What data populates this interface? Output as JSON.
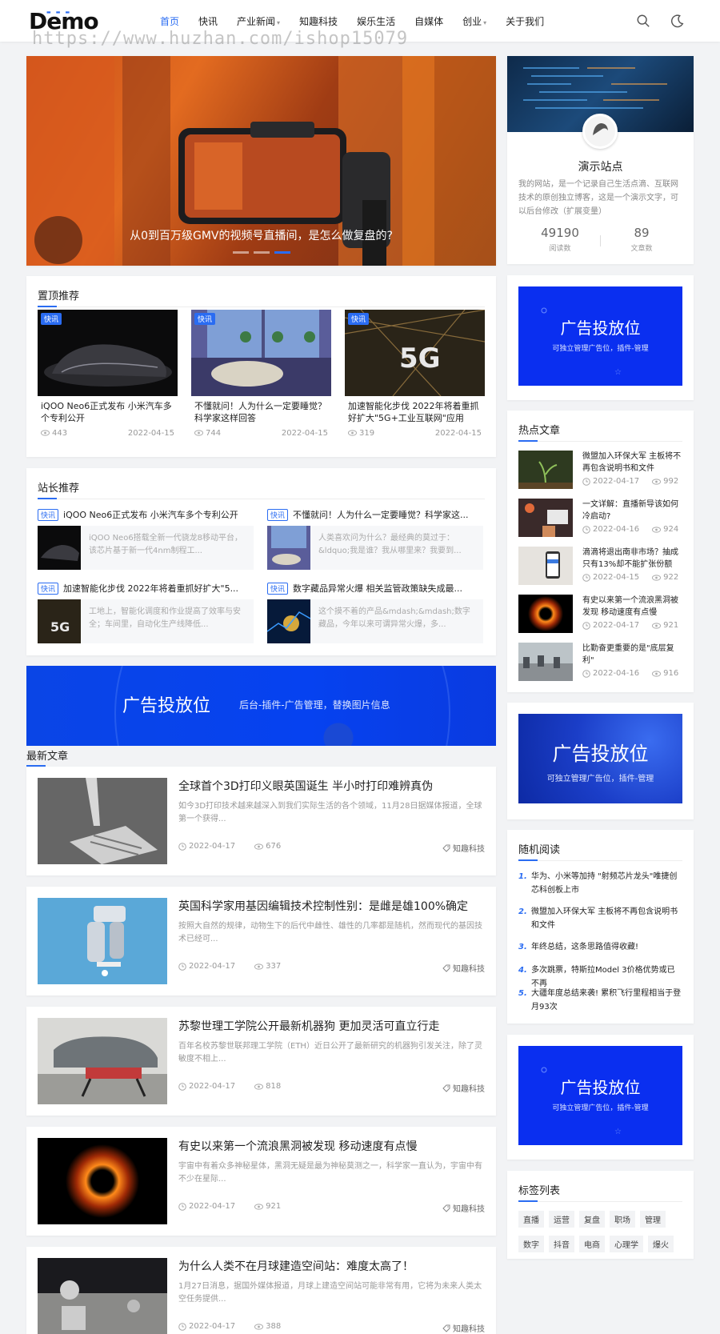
{
  "header": {
    "logo": "Demo",
    "nav": [
      {
        "label": "首页",
        "active": true,
        "has_dropdown": false
      },
      {
        "label": "快讯",
        "active": false,
        "has_dropdown": false
      },
      {
        "label": "产业新闻",
        "active": false,
        "has_dropdown": true
      },
      {
        "label": "知趣科技",
        "active": false,
        "has_dropdown": false
      },
      {
        "label": "娱乐生活",
        "active": false,
        "has_dropdown": false
      },
      {
        "label": "自媒体",
        "active": false,
        "has_dropdown": false
      },
      {
        "label": "创业",
        "active": false,
        "has_dropdown": true
      },
      {
        "label": "关于我们",
        "active": false,
        "has_dropdown": false
      }
    ],
    "watermark": "https://www.huzhan.com/ishop15079",
    "icons": [
      "search-icon",
      "moon-icon"
    ]
  },
  "hero": {
    "caption": "从0到百万级GMV的视频号直播间，是怎么做复盘的?",
    "slides": 3,
    "active_slide": 3
  },
  "top_recommend": {
    "title": "置顶推荐",
    "items": [
      {
        "tag": "快讯",
        "title": "iQOO Neo6正式发布 小米汽车多个专利公开",
        "views": "443",
        "date": "2022-04-15"
      },
      {
        "tag": "快讯",
        "title": "不懂就问！人为什么一定要睡觉？科学家这样回答",
        "views": "744",
        "date": "2022-04-15"
      },
      {
        "tag": "快讯",
        "title": "加速智能化步伐 2022年将着重抓好扩大\"5G+工业互联网\"应用",
        "views": "319",
        "date": "2022-04-15"
      }
    ]
  },
  "editor_recommend": {
    "title": "站长推荐",
    "items": [
      {
        "tag": "快讯",
        "title": "iQOO Neo6正式发布 小米汽车多个专利公开",
        "desc": "iQOO Neo6搭载全新一代骁龙8移动平台，该芯片基于新一代4nm制程工..."
      },
      {
        "tag": "快讯",
        "title": "不懂就问！人为什么一定要睡觉？科学家这...",
        "desc": "人类喜欢问为什么？最经典的莫过于：&ldquo;我是谁？我从哪里来？我要到..."
      },
      {
        "tag": "快讯",
        "title": "加速智能化步伐 2022年将着重抓好扩大\"5...",
        "desc": "工地上，智能化调度和作业提高了效率与安全；车间里，自动化生产线降低..."
      },
      {
        "tag": "快讯",
        "title": "数字藏品异常火爆 相关监管政策缺失成最...",
        "desc": "这个摸不着的产品&mdash;&mdash;数字藏品，今年以来可谓异常火爆，多..."
      }
    ]
  },
  "ad_wide": {
    "title": "广告投放位",
    "subtitle": "后台-插件-广告管理，替换图片信息"
  },
  "latest": {
    "title": "最新文章",
    "articles": [
      {
        "title": "全球首个3D打印义眼英国诞生 半小时打印难辨真伪",
        "desc": "如今3D打印技术越来越深入到我们实际生活的各个领域，11月28日据媒体报道，全球第一个获得...",
        "date": "2022-04-17",
        "views": "676",
        "category": "知趣科技"
      },
      {
        "title": "英国科学家用基因编辑技术控制性别：是雌是雄100%确定",
        "desc": "按照大自然的规律，动物生下的后代中雌性、雄性的几率都是随机，然而现代的基因技术已经可...",
        "date": "2022-04-17",
        "views": "337",
        "category": "知趣科技"
      },
      {
        "title": "苏黎世理工学院公开最新机器狗 更加灵活可直立行走",
        "desc": "百年名校苏黎世联邦理工学院（ETH）近日公开了最新研究的机器狗引发关注，除了灵敏度不相上...",
        "date": "2022-04-17",
        "views": "818",
        "category": "知趣科技"
      },
      {
        "title": "有史以来第一个流浪黑洞被发现 移动速度有点慢",
        "desc": "宇宙中有着众多神秘星体，黑洞无疑是最为神秘莫测之一，科学家一直认为，宇宙中有不少在星际...",
        "date": "2022-04-17",
        "views": "921",
        "category": "知趣科技"
      },
      {
        "title": "为什么人类不在月球建造空间站：难度太高了！",
        "desc": "1月27日消息，据国外媒体报道，月球上建造空间站可能非常有用，它将为未来人类太空任务提供...",
        "date": "2022-04-17",
        "views": "388",
        "category": "知趣科技"
      }
    ]
  },
  "sidebar": {
    "profile": {
      "name": "演示站点",
      "desc": "我的网站，是一个记录自己生活点滴、互联网技术的原创独立博客，这是一个演示文字，可以后台修改（扩展变量）",
      "stats": [
        {
          "num": "49190",
          "label": "阅读数"
        },
        {
          "num": "89",
          "label": "文章数"
        }
      ]
    },
    "ad1": {
      "title": "广告投放位",
      "subtitle": "可独立管理广告位，插件-管理"
    },
    "hot": {
      "title": "热点文章",
      "items": [
        {
          "title": "微盟加入环保大军 主板将不再包含说明书和文件",
          "date": "2022-04-17",
          "views": "992"
        },
        {
          "title": "一文详解：直播新导该如何冷启动?",
          "date": "2022-04-16",
          "views": "924"
        },
        {
          "title": "滴滴将退出南非市场？抽成只有13%却不能扩张份额",
          "date": "2022-04-15",
          "views": "922"
        },
        {
          "title": "有史以来第一个流浪黑洞被发现 移动速度有点慢",
          "date": "2022-04-17",
          "views": "921"
        },
        {
          "title": "比勤奋更重要的是\"底层复利\"",
          "date": "2022-04-16",
          "views": "916"
        }
      ]
    },
    "ad2": {
      "title": "广告投放位",
      "subtitle": "可独立管理广告位，插件-管理"
    },
    "random": {
      "title": "随机阅读",
      "items": [
        {
          "num": "1.",
          "title": "华为、小米等加持 \"射频芯片龙头\"唯捷创芯科创板上市"
        },
        {
          "num": "2.",
          "title": "微盟加入环保大军 主板将不再包含说明书和文件"
        },
        {
          "num": "3.",
          "title": "年终总结，这条思路值得收藏!"
        },
        {
          "num": "4.",
          "title": "多次跳票，特斯拉Model 3价格优势或已不再"
        },
        {
          "num": "5.",
          "title": "大疆年度总结来袭! 累积飞行里程相当于登月93次"
        }
      ]
    },
    "ad3": {
      "title": "广告投放位",
      "subtitle": "可独立管理广告位，插件-管理"
    },
    "tags": {
      "title": "标签列表",
      "items": [
        "直播",
        "运营",
        "复盘",
        "职场",
        "管理",
        "数字",
        "抖音",
        "电商",
        "心理学",
        "爆火"
      ]
    }
  },
  "colors": {
    "accent": "#2a6cf2",
    "ad_blue": "#0a2ff0",
    "background": "#f2f3f5"
  }
}
